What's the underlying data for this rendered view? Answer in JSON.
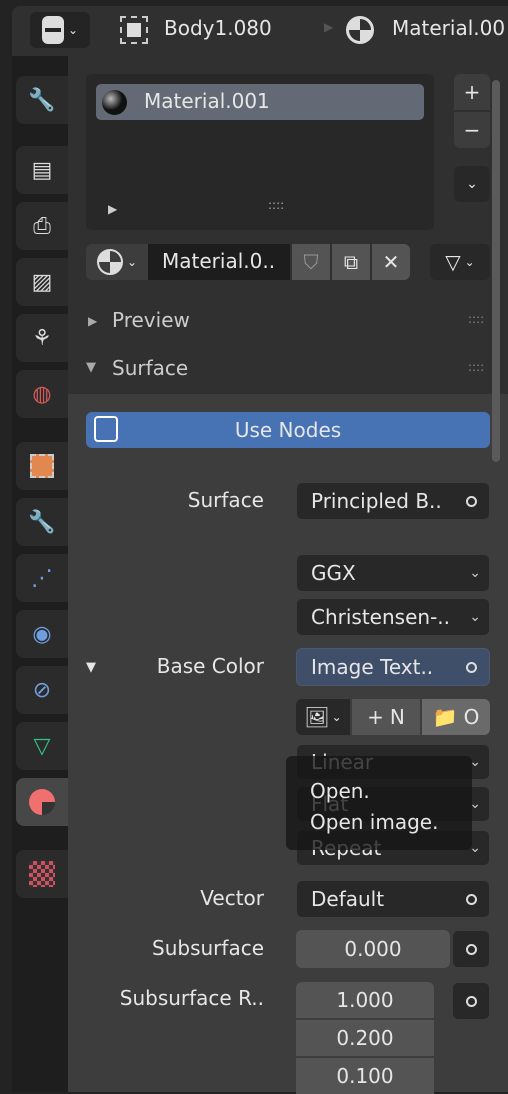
{
  "header": {
    "object_name": "Body1.080",
    "material_name": "Material.00"
  },
  "sidebar": {
    "tabs": [
      {
        "icon": "tool-icon"
      },
      {
        "icon": "render-icon"
      },
      {
        "icon": "output-icon"
      },
      {
        "icon": "view-layer-icon"
      },
      {
        "icon": "scene-icon"
      },
      {
        "icon": "world-icon"
      },
      {
        "icon": "object-icon"
      },
      {
        "icon": "modifier-icon"
      },
      {
        "icon": "particles-icon"
      },
      {
        "icon": "physics-icon"
      },
      {
        "icon": "constraints-icon"
      },
      {
        "icon": "data-icon"
      },
      {
        "icon": "material-icon",
        "active": true
      },
      {
        "icon": "texture-icon"
      }
    ]
  },
  "material_slots": {
    "items": [
      "Material.001"
    ]
  },
  "material_selector": {
    "name": "Material.0.."
  },
  "panels": {
    "preview": "Preview",
    "surface": "Surface"
  },
  "use_nodes": "Use Nodes",
  "props": {
    "surface_label": "Surface",
    "surface_value": "Principled B..",
    "distribution": "GGX",
    "subsurface_method": "Christensen-..",
    "base_color_label": "Base Color",
    "base_color_value": "Image Text..",
    "new_label": "N",
    "open_label": "O",
    "interpolation": "Linear",
    "projection": "Flat",
    "extension": "Repeat",
    "vector_label": "Vector",
    "vector_value": "Default",
    "subsurface_label": "Subsurface",
    "subsurface_value": "0.000",
    "subsurface_radius_label": "Subsurface R..",
    "subsurface_radius": [
      "1.000",
      "0.200",
      "0.100"
    ]
  },
  "tooltip": {
    "title": "Open.",
    "description": "Open image."
  },
  "colors": {
    "accent": "#4772b3",
    "active_item": "#646a75"
  }
}
